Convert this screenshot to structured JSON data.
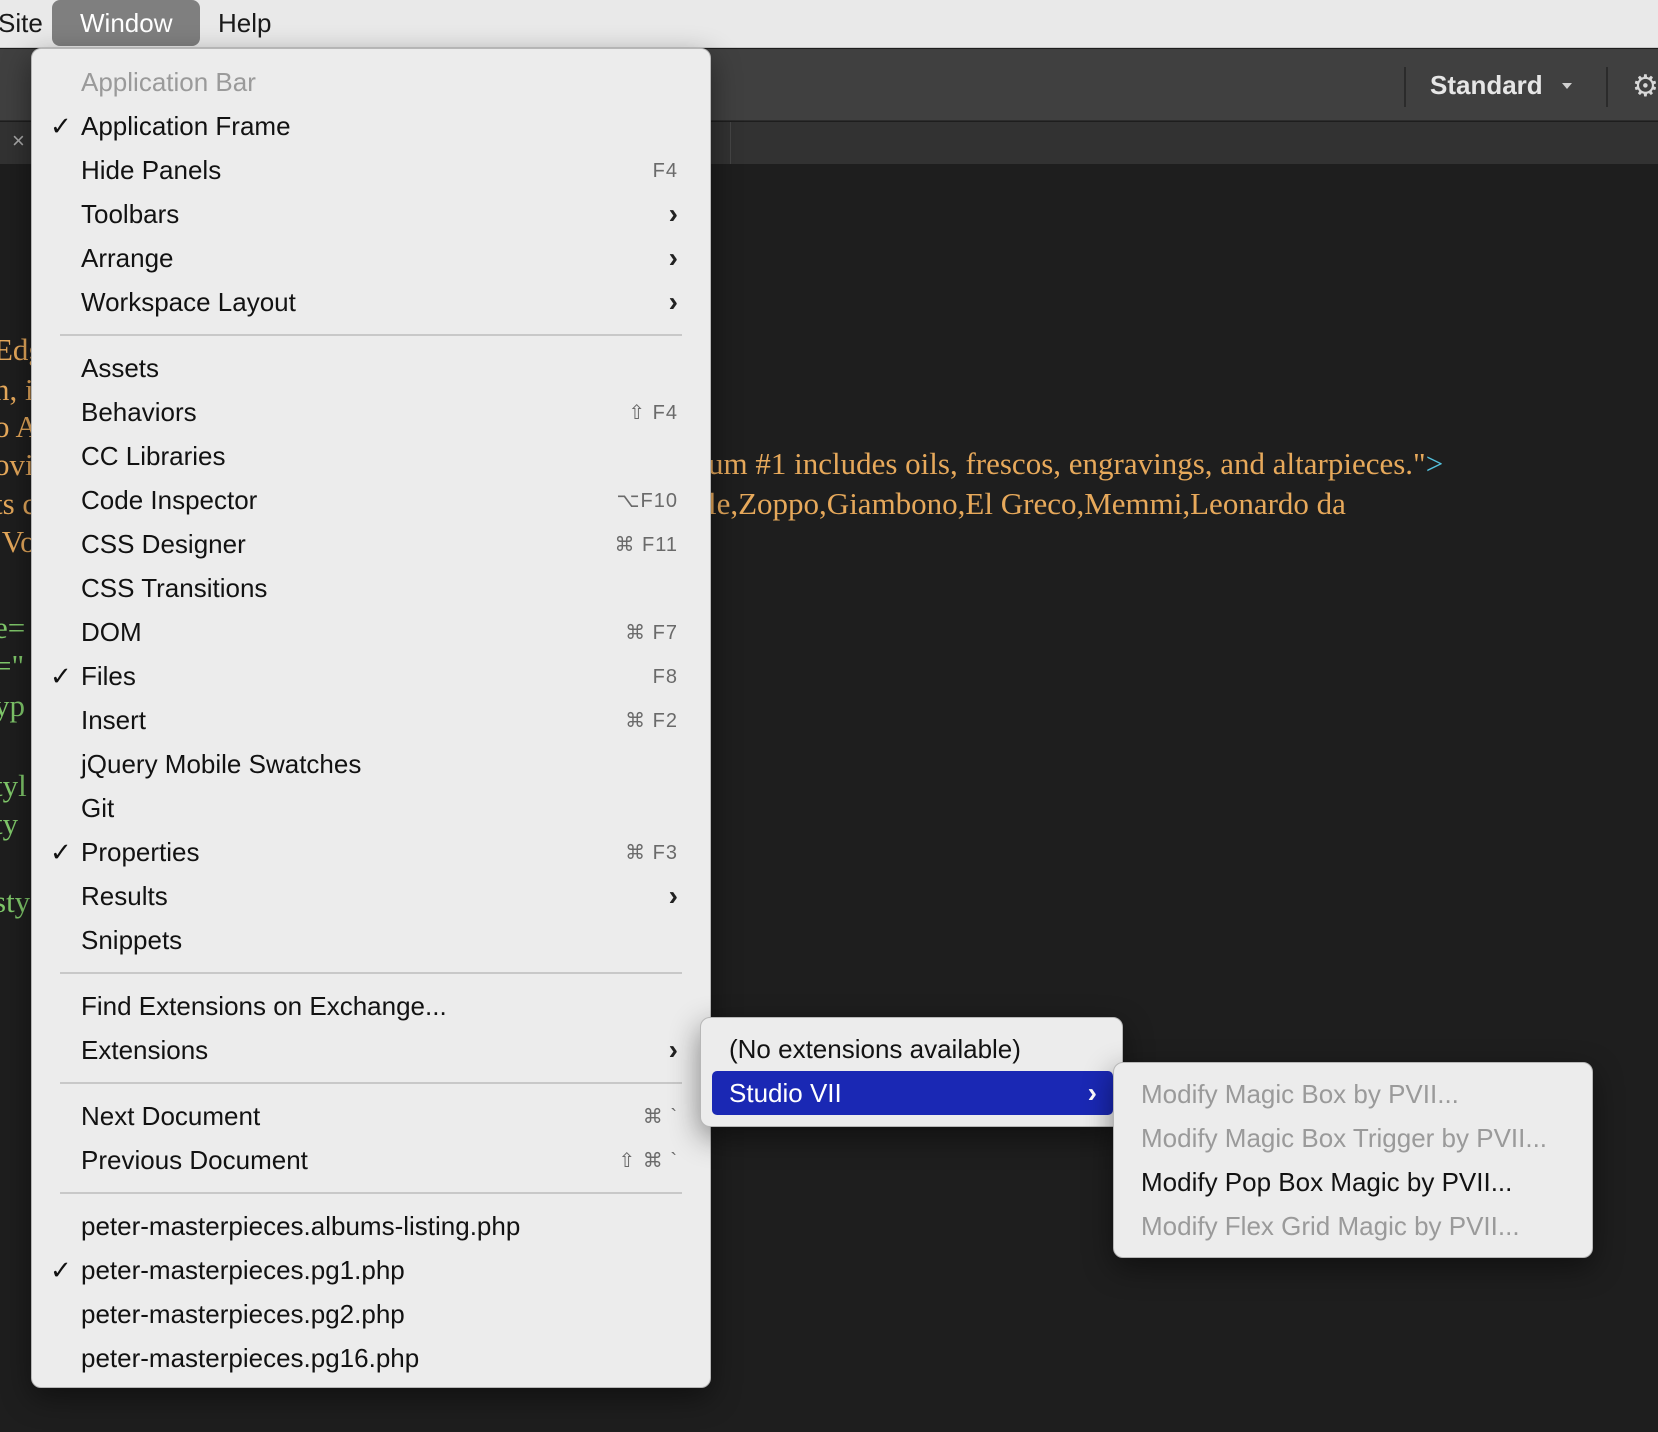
{
  "menubar": {
    "items": [
      {
        "label": "Site"
      },
      {
        "label": "Window"
      },
      {
        "label": "Help"
      }
    ]
  },
  "toolbar": {
    "workspace": "Standard"
  },
  "editor": {
    "code_lines": [
      "Edg",
      "n, i",
      "o A",
      "ovi",
      "ts c",
      ",Vo",
      "e=",
      "=\"",
      "yp",
      "tyl",
      "ty",
      "sty"
    ],
    "line_a": "um #1 includes oils, frescos, engravings, and altarpieces.\"",
    "line_a_end": ">",
    "line_b": "le,Zoppo,Giambono,El Greco,Memmi,Leonardo da"
  },
  "window_menu": {
    "items": [
      {
        "label": "Application Bar",
        "disabled": true
      },
      {
        "label": "Application Frame",
        "checked": true
      },
      {
        "label": "Hide Panels",
        "shortcut": "F4"
      },
      {
        "label": "Toolbars",
        "submenu": true
      },
      {
        "label": "Arrange",
        "submenu": true
      },
      {
        "label": "Workspace Layout",
        "submenu": true
      },
      {
        "label": "Assets"
      },
      {
        "label": "Behaviors",
        "shortcut": "⇧ F4"
      },
      {
        "label": "CC Libraries"
      },
      {
        "label": "Code Inspector",
        "shortcut": "⌥F10"
      },
      {
        "label": "CSS Designer",
        "shortcut": "⌘ F11"
      },
      {
        "label": "CSS Transitions"
      },
      {
        "label": "DOM",
        "shortcut": "⌘ F7"
      },
      {
        "label": "Files",
        "checked": true,
        "shortcut": "F8"
      },
      {
        "label": "Insert",
        "shortcut": "⌘ F2"
      },
      {
        "label": "jQuery Mobile Swatches"
      },
      {
        "label": "Git"
      },
      {
        "label": "Properties",
        "checked": true,
        "shortcut": "⌘ F3"
      },
      {
        "label": "Results",
        "submenu": true
      },
      {
        "label": "Snippets"
      },
      {
        "label": "Find Extensions on Exchange..."
      },
      {
        "label": "Extensions",
        "submenu": true
      },
      {
        "label": "Next Document",
        "shortcut": "⌘ `"
      },
      {
        "label": "Previous Document",
        "shortcut": "⇧ ⌘ `"
      },
      {
        "label": "peter-masterpieces.albums-listing.php"
      },
      {
        "label": "peter-masterpieces.pg1.php",
        "checked": true
      },
      {
        "label": "peter-masterpieces.pg2.php"
      },
      {
        "label": "peter-masterpieces.pg16.php"
      }
    ]
  },
  "extensions_menu": {
    "items": [
      {
        "label": "(No extensions available)"
      },
      {
        "label": "Studio VII",
        "submenu": true,
        "highlighted": true
      }
    ]
  },
  "studio_menu": {
    "items": [
      {
        "label": "Modify Magic Box by PVII...",
        "disabled": true
      },
      {
        "label": "Modify Magic Box Trigger by PVII...",
        "disabled": true
      },
      {
        "label": "Modify Pop Box Magic by PVII...",
        "disabled": false
      },
      {
        "label": "Modify Flex Grid Magic by PVII...",
        "disabled": true
      }
    ]
  },
  "glyphs": {
    "check": "✓",
    "arrow": "›",
    "close": "×",
    "gear": "⚙"
  }
}
